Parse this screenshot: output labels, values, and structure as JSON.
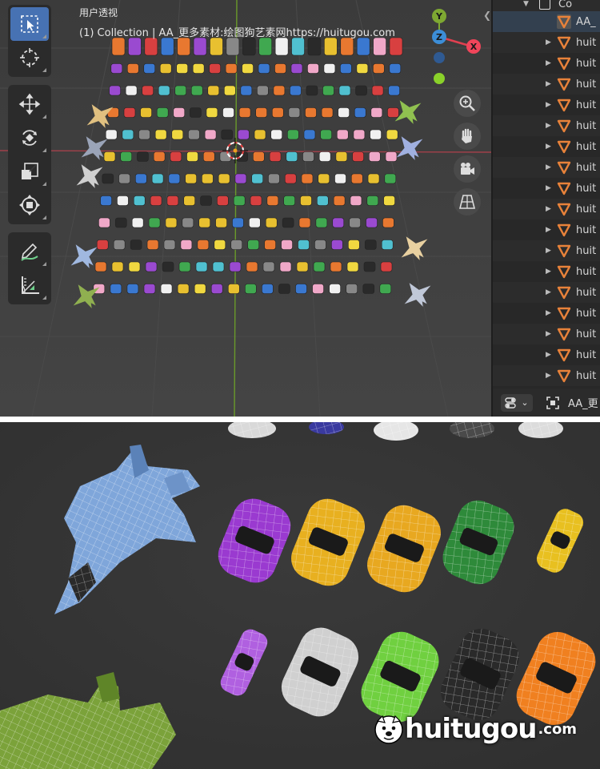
{
  "viewport": {
    "view_name": "用户透视",
    "collection_line": "(1) Collection | AA_更多素材:绘图狗艺素网https://huitugou.com"
  },
  "toolbar": {
    "tools": [
      "select-box",
      "cursor",
      "move",
      "rotate",
      "scale",
      "transform",
      "annotate",
      "measure"
    ],
    "active": "select-box"
  },
  "gizmo": {
    "y_label": "Y",
    "z_label": "Z",
    "x_label": "X",
    "colors": {
      "x": "#f0455a",
      "y": "#8bbf2d",
      "z": "#3c8ed8"
    }
  },
  "navigation": [
    "zoom-icon",
    "pan-hand-icon",
    "camera-icon",
    "perspective-grid-icon"
  ],
  "outliner": {
    "top_label": "Co",
    "rows": [
      "AA_",
      "huit",
      "huit",
      "huit",
      "huit",
      "huit",
      "huit",
      "huit",
      "huit",
      "huit",
      "huit",
      "huit",
      "huit",
      "huit",
      "huit",
      "huit",
      "huit",
      "huit"
    ],
    "footer_label": "AA_更"
  },
  "watermark": {
    "brand": "huitugou",
    "domain": ".com"
  },
  "colors": {
    "accent": "#4772b3",
    "mesh_icon": "#e8823a",
    "axis_red": "#a0404a",
    "axis_green": "#6a9a2a"
  }
}
